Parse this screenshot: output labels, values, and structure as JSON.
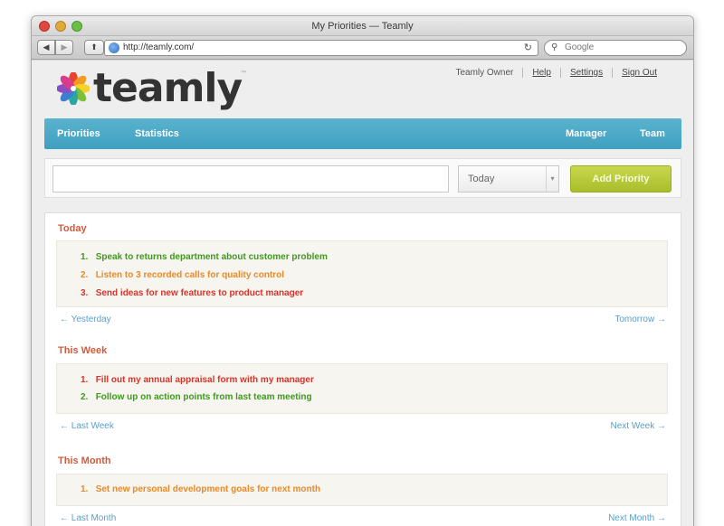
{
  "window": {
    "title": "My Priorities — Teamly",
    "url": "http://teamly.com/",
    "search_placeholder": "Google"
  },
  "header": {
    "logo_text": "teamly",
    "top_links": [
      "Teamly Owner",
      "Help",
      "Settings",
      "Sign Out"
    ]
  },
  "nav": {
    "left": [
      "Priorities",
      "Statistics"
    ],
    "right": [
      "Manager",
      "Team"
    ]
  },
  "entry": {
    "input_value": "",
    "select_value": "Today",
    "add_button_label": "Add Priority"
  },
  "sections": {
    "today": {
      "title": "Today",
      "items": [
        {
          "num": "1.",
          "text": "Speak to returns department about customer problem"
        },
        {
          "num": "2.",
          "text": "Listen to 3 recorded calls for quality control"
        },
        {
          "num": "3.",
          "text": "Send ideas for new features to product manager"
        }
      ],
      "prev": "← Yesterday",
      "next": "Tomorrow →"
    },
    "week": {
      "title": "This Week",
      "items": [
        {
          "num": "1.",
          "text": "Fill out my annual appraisal form with my manager"
        },
        {
          "num": "2.",
          "text": "Follow up on action points from last team meeting"
        }
      ],
      "prev": "← Last Week",
      "next": "Next Week →"
    },
    "month": {
      "title": "This Month",
      "items": [
        {
          "num": "1.",
          "text": "Set new personal development goals for next month"
        }
      ],
      "prev": "← Last Month",
      "next": "Next Month →"
    }
  },
  "colors": {
    "nav_bar": "#4aa8c6",
    "add_button": "#b9cb38",
    "section_title": "#d55a3a",
    "green": "#3f9a1e",
    "orange": "#e88a2a",
    "red": "#d6342a",
    "pager_link": "#5a9fc8"
  }
}
